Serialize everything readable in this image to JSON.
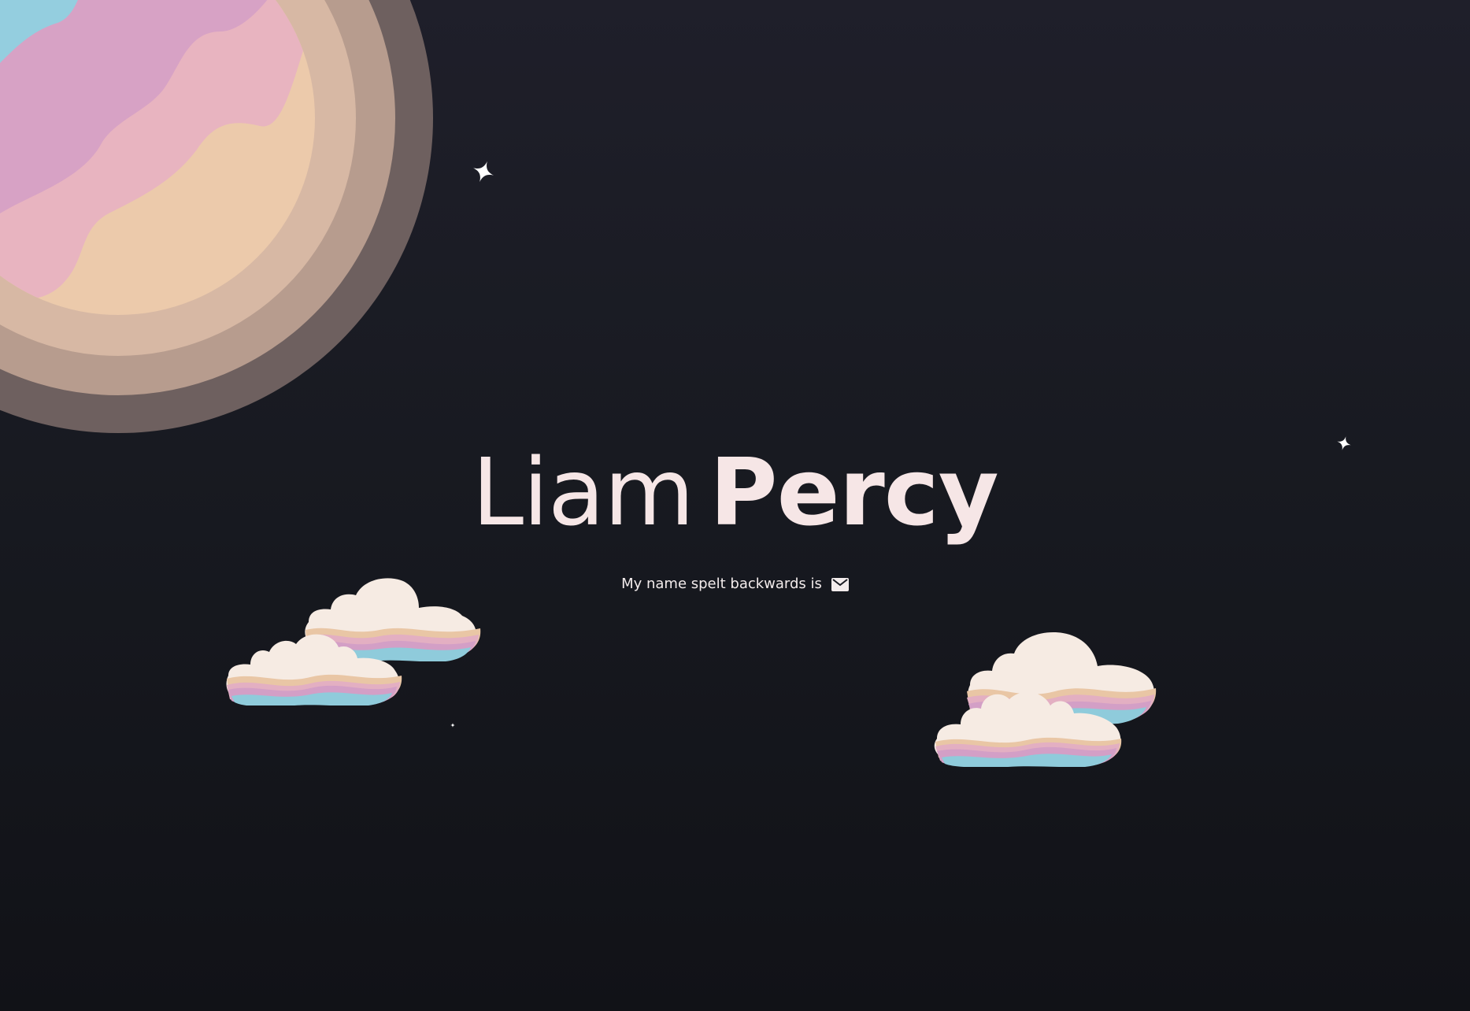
{
  "hero": {
    "first_name": "Liam",
    "last_name": "Percy",
    "contact_text": "My name spelt backwards is"
  },
  "icons": {
    "contact": "envelope-icon"
  },
  "colors": {
    "text": "#f6e6e6",
    "background_top": "#1f1f2a",
    "background_bottom": "#111217",
    "planet_blue": "#90cfe0",
    "planet_pink": "#d8a0c4",
    "planet_peach": "#eccaab",
    "cloud_cream": "#f6ebe3"
  }
}
